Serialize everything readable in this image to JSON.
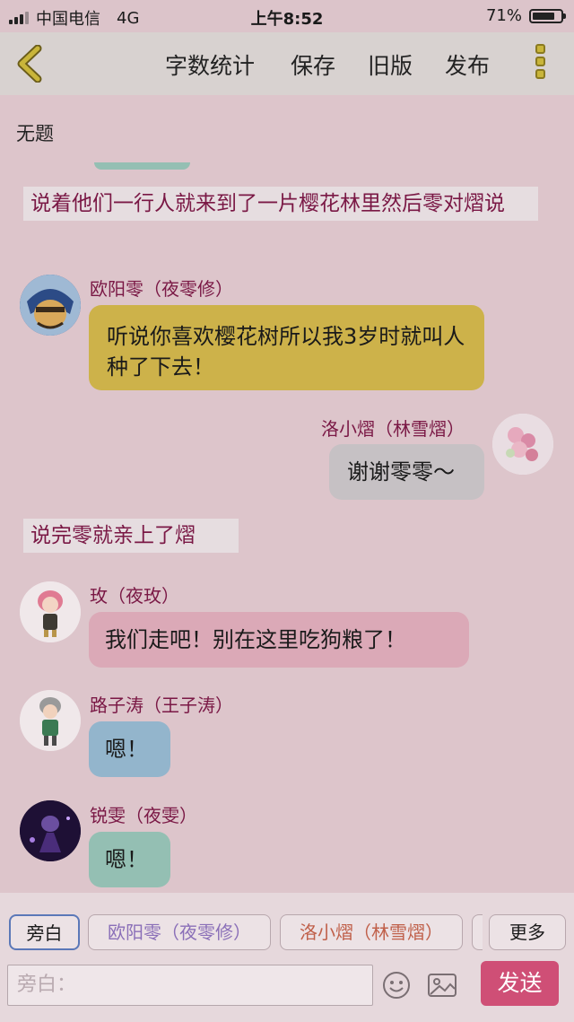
{
  "status": {
    "carrier": "中国电信",
    "network": "4G",
    "time": "上午8:52",
    "battery": "71%",
    "battery_level": 0.71
  },
  "toolbar": {
    "word_count": "字数统计",
    "save": "保存",
    "old_version": "旧版",
    "publish": "发布"
  },
  "doc_title": "无题",
  "narration": [
    "说着他们一行人就来到了一片樱花林里然后零对熠说",
    "说完零就亲上了熠"
  ],
  "messages": [
    {
      "name": "欧阳零（夜零修）",
      "text": "听说你喜欢樱花树所以我3岁时就叫人种了下去！",
      "color": "#cdb24a"
    },
    {
      "name": "洛小熠（林雪熠）",
      "text": "谢谢零零～",
      "color": "#c6c1c4"
    },
    {
      "name": "玫（夜玫）",
      "text": "我们走吧！别在这里吃狗粮了！",
      "color": "#dba9b7"
    },
    {
      "name": "路子涛（王子涛）",
      "text": "嗯！",
      "color": "#93b5cc"
    },
    {
      "name": "锐雯（夜雯）",
      "text": "嗯！",
      "color": "#94bfb3"
    }
  ],
  "bottom": {
    "chips": [
      "旁白",
      "欧阳零（夜零修）",
      "洛小熠（林雪熠）"
    ],
    "more": "更多",
    "input_placeholder": "旁白：",
    "send": "发送"
  },
  "colors": {
    "accent": "#cf4f76",
    "name_text": "#7a1845"
  }
}
